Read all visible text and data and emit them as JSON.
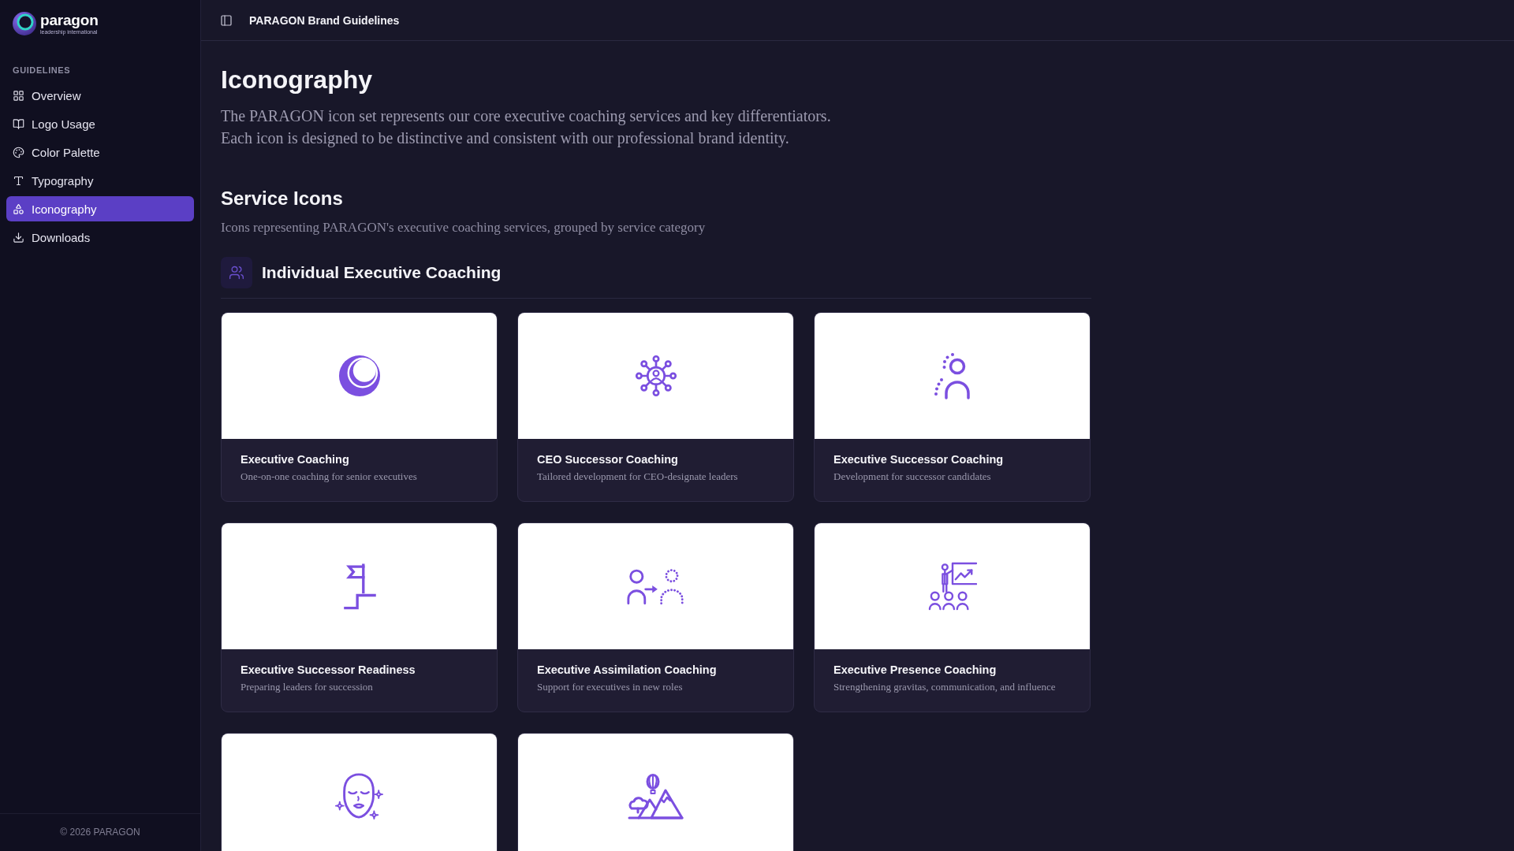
{
  "sidebar": {
    "logo": {
      "name": "paragon",
      "tagline": "leadership international"
    },
    "section_label": "GUIDELINES",
    "items": [
      {
        "label": "Overview",
        "selected": false
      },
      {
        "label": "Logo Usage",
        "selected": false
      },
      {
        "label": "Color Palette",
        "selected": false
      },
      {
        "label": "Typography",
        "selected": false
      },
      {
        "label": "Iconography",
        "selected": true
      },
      {
        "label": "Downloads",
        "selected": false
      }
    ],
    "footer": "© 2026 PARAGON"
  },
  "header": {
    "title": "PARAGON Brand Guidelines"
  },
  "page": {
    "title": "Iconography",
    "intro": "The PARAGON icon set represents our core executive coaching services and key differentiators. Each icon is designed to be distinctive and consistent with our professional brand identity."
  },
  "section": {
    "title": "Service Icons",
    "subtitle": "Icons representing PARAGON's executive coaching services, grouped by service category",
    "group": {
      "title": "Individual Executive Coaching",
      "cards": [
        {
          "kind": "full",
          "title": "Executive Coaching",
          "description": "One-on-one coaching for senior executives"
        },
        {
          "kind": "full",
          "title": "CEO Successor Coaching",
          "description": "Tailored development for CEO-designate leaders"
        },
        {
          "kind": "full",
          "title": "Executive Successor Coaching",
          "description": "Development for successor candidates"
        },
        {
          "kind": "full",
          "title": "Executive Successor Readiness",
          "description": "Preparing leaders for succession"
        },
        {
          "kind": "full",
          "title": "Executive Assimilation Coaching",
          "description": "Support for executives in new roles"
        },
        {
          "kind": "full",
          "title": "Executive Presence Coaching",
          "description": "Strengthening gravitas, communication, and influence"
        },
        {
          "kind": "preview_only"
        },
        {
          "kind": "preview_only"
        }
      ]
    }
  }
}
